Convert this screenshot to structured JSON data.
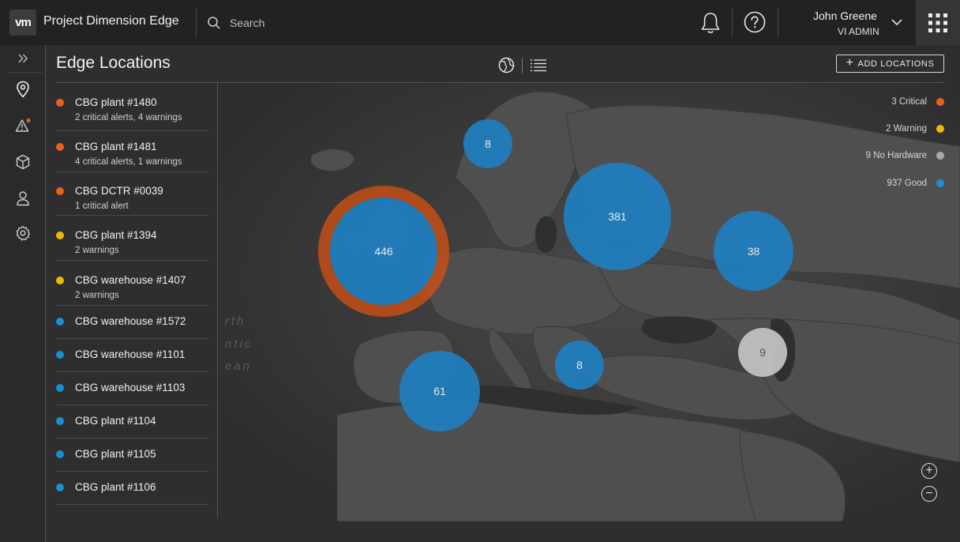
{
  "header": {
    "logo": "vm",
    "title": "Project Dimension Edge",
    "search_placeholder": "Search",
    "user_name": "John Greene",
    "user_role": "VI ADMIN"
  },
  "page": {
    "title": "Edge Locations",
    "add_button": "ADD LOCATIONS",
    "add_icon": "+"
  },
  "colors": {
    "critical": "#e8611a",
    "warning": "#f2b705",
    "no_hardware": "#a8a8a8",
    "good": "#1a8fd6"
  },
  "locations": [
    {
      "name": "CBG plant #1480",
      "sub": "2 critical alerts, 4 warnings",
      "status": "critical"
    },
    {
      "name": "CBG plant #1481",
      "sub": "4 critical alerts, 1 warnings",
      "status": "critical"
    },
    {
      "name": "CBG DCTR #0039",
      "sub": " 1 critical alert",
      "status": "critical"
    },
    {
      "name": "CBG plant #1394",
      "sub": "2 warnings",
      "status": "warning"
    },
    {
      "name": "CBG warehouse #1407",
      "sub": "2 warnings",
      "status": "warning"
    },
    {
      "name": "CBG warehouse #1572",
      "sub": "",
      "status": "good"
    },
    {
      "name": "CBG warehouse #1101",
      "sub": "",
      "status": "good"
    },
    {
      "name": "CBG warehouse #1103",
      "sub": "",
      "status": "good"
    },
    {
      "name": "CBG plant #1104",
      "sub": "",
      "status": "good"
    },
    {
      "name": "CBG plant #1105",
      "sub": "",
      "status": "good"
    },
    {
      "name": "CBG plant #1106",
      "sub": "",
      "status": "good"
    }
  ],
  "legend": [
    {
      "label": "3 Critical",
      "status": "critical"
    },
    {
      "label": "2 Warning",
      "status": "warning"
    },
    {
      "label": "9 No Hardware",
      "status": "no_hardware"
    },
    {
      "label": "937 Good",
      "status": "good"
    }
  ],
  "clusters": [
    {
      "count": "446",
      "alert": true
    },
    {
      "count": "8"
    },
    {
      "count": "381"
    },
    {
      "count": "38"
    },
    {
      "count": "9",
      "no_hardware": true
    },
    {
      "count": "8"
    },
    {
      "count": "61"
    }
  ],
  "map_labels": {
    "ocean_1": "rth",
    "ocean_2": "ntic",
    "ocean_3": "ean"
  },
  "zoom": {
    "in": "+",
    "out": "−"
  }
}
